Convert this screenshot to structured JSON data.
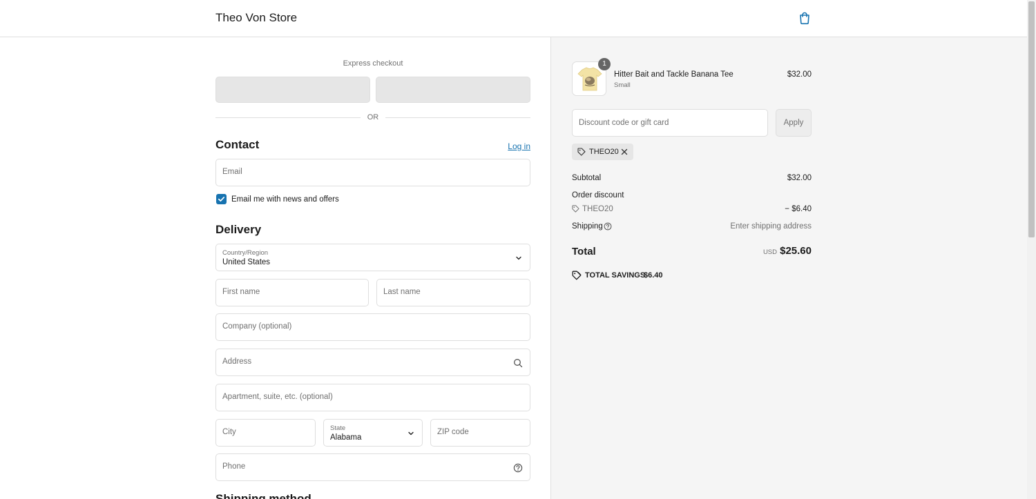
{
  "header": {
    "store_title": "Theo Von Store"
  },
  "express": {
    "label": "Express checkout",
    "or": "OR"
  },
  "contact": {
    "title": "Contact",
    "login": "Log in",
    "email_placeholder": "Email",
    "newsletter_label": "Email me with news and offers",
    "newsletter_checked": true
  },
  "delivery": {
    "title": "Delivery",
    "country_label": "Country/Region",
    "country_value": "United States",
    "first_name": "First name",
    "last_name": "Last name",
    "company": "Company (optional)",
    "address": "Address",
    "apartment": "Apartment, suite, etc. (optional)",
    "city": "City",
    "state_label": "State",
    "state_value": "Alabama",
    "zip": "ZIP code",
    "phone": "Phone"
  },
  "next_section": {
    "title": "Shipping method"
  },
  "summary": {
    "item": {
      "name": "Hitter Bait and Tackle Banana Tee",
      "variant": "Small",
      "price": "$32.00",
      "quantity": "1"
    },
    "discount_placeholder": "Discount code or gift card",
    "apply": "Apply",
    "applied_code": "THEO20",
    "subtotal_label": "Subtotal",
    "subtotal_value": "$32.00",
    "order_discount_label": "Order discount",
    "discount_code": "THEO20",
    "discount_value": "− $6.40",
    "shipping_label": "Shipping",
    "shipping_value": "Enter shipping address",
    "total_label": "Total",
    "currency": "USD",
    "total_value": "$25.60",
    "savings_label": "TOTAL SAVINGS",
    "savings_value": "$6.40"
  },
  "colors": {
    "accent": "#1773b0",
    "panel_bg": "#f5f5f5",
    "border": "#dedede"
  }
}
